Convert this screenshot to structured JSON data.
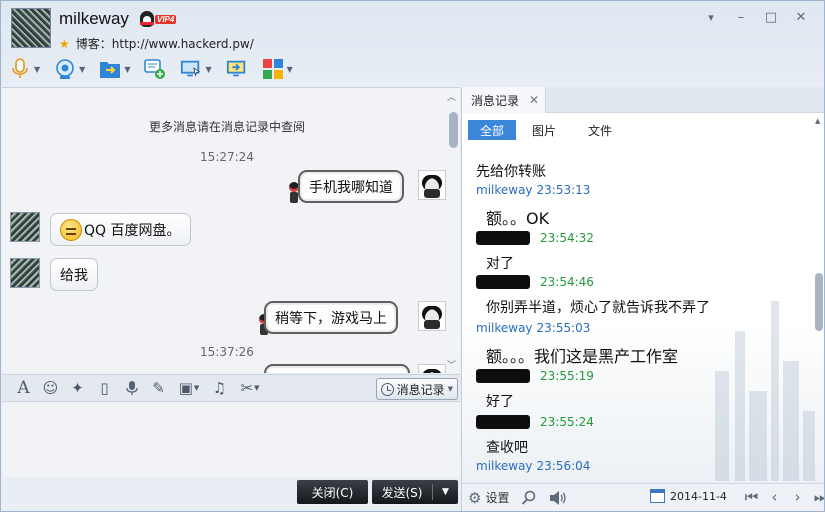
{
  "header": {
    "nickname": "milkeway",
    "vip_label": "VIP4",
    "signature_label": "博客：",
    "signature_url": "http://www.hackerd.pw/",
    "window_buttons": {
      "pin": "▾",
      "minimize": "–",
      "maximize": "□",
      "close": "✕"
    }
  },
  "toolbar": [
    "voice-call",
    "video-call",
    "send-file",
    "create-group-chat",
    "remote-assist",
    "share-screen",
    "apps"
  ],
  "chat": {
    "more_notice": "更多消息请在消息记录中查阅",
    "messages": [
      {
        "type": "time",
        "text": "15:27:24"
      },
      {
        "type": "out",
        "text": "手机我哪知道"
      },
      {
        "type": "in",
        "text": "QQ 百度网盘。",
        "emoji": true
      },
      {
        "type": "in",
        "text": "给我"
      },
      {
        "type": "out",
        "text": "稍等下，游戏马上"
      },
      {
        "type": "time",
        "text": "15:37:26"
      }
    ]
  },
  "input_toolbar": {
    "icons": [
      "font-icon",
      "emoji-icon",
      "magic-emoticon-icon",
      "shake-icon",
      "voice-message-icon",
      "doodle-icon",
      "image-icon",
      "music-icon",
      "screenshot-icon"
    ],
    "history_button": "消息记录"
  },
  "actions": {
    "close": "关闭(C)",
    "send": "发送(S)",
    "send_options": "▼"
  },
  "history": {
    "tab_label": "消息记录",
    "filters": {
      "all": "全部",
      "images": "图片",
      "files": "文件"
    },
    "entries": [
      {
        "sender": "milkeway",
        "time": "23:53:13",
        "text": "先给你转账",
        "meta_first": false
      },
      {
        "sender": "milkeway",
        "time": "23:53:13",
        "text": "额。。OK"
      },
      {
        "sender": "",
        "time": "23:54:32",
        "text": "对了"
      },
      {
        "sender": "",
        "time": "23:54:46",
        "text": "你别弄半道，烦心了就告诉我不弄了"
      },
      {
        "sender": "milkeway",
        "time": "23:55:03",
        "text": "额。。。我们这是黑产工作室"
      },
      {
        "sender": "",
        "time": "23:55:19",
        "text": "好了"
      },
      {
        "sender": "",
        "time": "23:55:24",
        "text": "查收吧"
      },
      {
        "sender": "milkeway",
        "time": "23:56:04",
        "text": ""
      }
    ],
    "footer": {
      "settings": "设置",
      "date": "2014-11-4"
    }
  },
  "colors": {
    "accent": "#3b86d9",
    "sender_blue": "#2a6cc0",
    "time_green": "#1f9b3a"
  }
}
